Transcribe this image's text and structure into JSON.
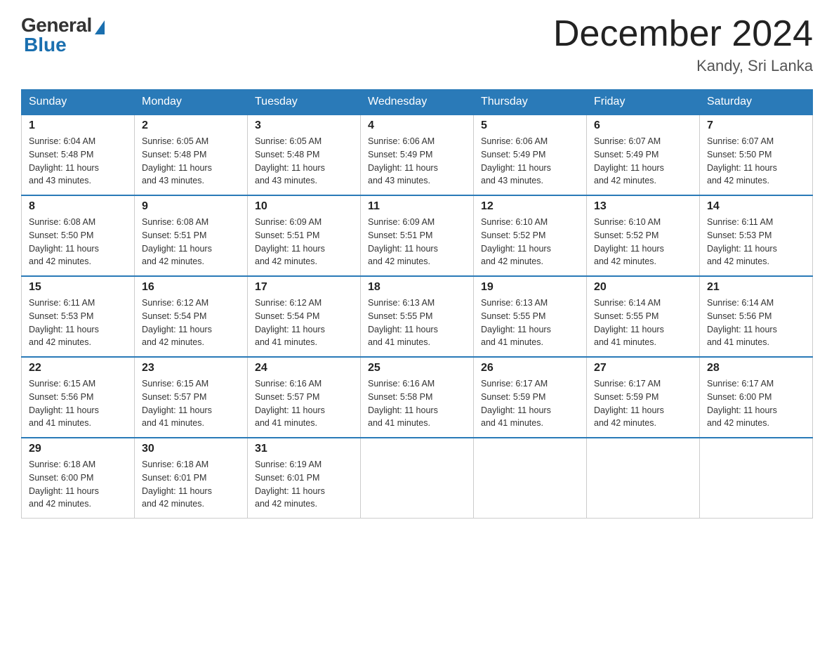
{
  "logo": {
    "general": "General",
    "blue": "Blue"
  },
  "title": "December 2024",
  "location": "Kandy, Sri Lanka",
  "weekdays": [
    "Sunday",
    "Monday",
    "Tuesday",
    "Wednesday",
    "Thursday",
    "Friday",
    "Saturday"
  ],
  "weeks": [
    [
      {
        "day": "1",
        "sunrise": "6:04 AM",
        "sunset": "5:48 PM",
        "daylight": "11 hours and 43 minutes."
      },
      {
        "day": "2",
        "sunrise": "6:05 AM",
        "sunset": "5:48 PM",
        "daylight": "11 hours and 43 minutes."
      },
      {
        "day": "3",
        "sunrise": "6:05 AM",
        "sunset": "5:48 PM",
        "daylight": "11 hours and 43 minutes."
      },
      {
        "day": "4",
        "sunrise": "6:06 AM",
        "sunset": "5:49 PM",
        "daylight": "11 hours and 43 minutes."
      },
      {
        "day": "5",
        "sunrise": "6:06 AM",
        "sunset": "5:49 PM",
        "daylight": "11 hours and 43 minutes."
      },
      {
        "day": "6",
        "sunrise": "6:07 AM",
        "sunset": "5:49 PM",
        "daylight": "11 hours and 42 minutes."
      },
      {
        "day": "7",
        "sunrise": "6:07 AM",
        "sunset": "5:50 PM",
        "daylight": "11 hours and 42 minutes."
      }
    ],
    [
      {
        "day": "8",
        "sunrise": "6:08 AM",
        "sunset": "5:50 PM",
        "daylight": "11 hours and 42 minutes."
      },
      {
        "day": "9",
        "sunrise": "6:08 AM",
        "sunset": "5:51 PM",
        "daylight": "11 hours and 42 minutes."
      },
      {
        "day": "10",
        "sunrise": "6:09 AM",
        "sunset": "5:51 PM",
        "daylight": "11 hours and 42 minutes."
      },
      {
        "day": "11",
        "sunrise": "6:09 AM",
        "sunset": "5:51 PM",
        "daylight": "11 hours and 42 minutes."
      },
      {
        "day": "12",
        "sunrise": "6:10 AM",
        "sunset": "5:52 PM",
        "daylight": "11 hours and 42 minutes."
      },
      {
        "day": "13",
        "sunrise": "6:10 AM",
        "sunset": "5:52 PM",
        "daylight": "11 hours and 42 minutes."
      },
      {
        "day": "14",
        "sunrise": "6:11 AM",
        "sunset": "5:53 PM",
        "daylight": "11 hours and 42 minutes."
      }
    ],
    [
      {
        "day": "15",
        "sunrise": "6:11 AM",
        "sunset": "5:53 PM",
        "daylight": "11 hours and 42 minutes."
      },
      {
        "day": "16",
        "sunrise": "6:12 AM",
        "sunset": "5:54 PM",
        "daylight": "11 hours and 42 minutes."
      },
      {
        "day": "17",
        "sunrise": "6:12 AM",
        "sunset": "5:54 PM",
        "daylight": "11 hours and 41 minutes."
      },
      {
        "day": "18",
        "sunrise": "6:13 AM",
        "sunset": "5:55 PM",
        "daylight": "11 hours and 41 minutes."
      },
      {
        "day": "19",
        "sunrise": "6:13 AM",
        "sunset": "5:55 PM",
        "daylight": "11 hours and 41 minutes."
      },
      {
        "day": "20",
        "sunrise": "6:14 AM",
        "sunset": "5:55 PM",
        "daylight": "11 hours and 41 minutes."
      },
      {
        "day": "21",
        "sunrise": "6:14 AM",
        "sunset": "5:56 PM",
        "daylight": "11 hours and 41 minutes."
      }
    ],
    [
      {
        "day": "22",
        "sunrise": "6:15 AM",
        "sunset": "5:56 PM",
        "daylight": "11 hours and 41 minutes."
      },
      {
        "day": "23",
        "sunrise": "6:15 AM",
        "sunset": "5:57 PM",
        "daylight": "11 hours and 41 minutes."
      },
      {
        "day": "24",
        "sunrise": "6:16 AM",
        "sunset": "5:57 PM",
        "daylight": "11 hours and 41 minutes."
      },
      {
        "day": "25",
        "sunrise": "6:16 AM",
        "sunset": "5:58 PM",
        "daylight": "11 hours and 41 minutes."
      },
      {
        "day": "26",
        "sunrise": "6:17 AM",
        "sunset": "5:59 PM",
        "daylight": "11 hours and 41 minutes."
      },
      {
        "day": "27",
        "sunrise": "6:17 AM",
        "sunset": "5:59 PM",
        "daylight": "11 hours and 42 minutes."
      },
      {
        "day": "28",
        "sunrise": "6:17 AM",
        "sunset": "6:00 PM",
        "daylight": "11 hours and 42 minutes."
      }
    ],
    [
      {
        "day": "29",
        "sunrise": "6:18 AM",
        "sunset": "6:00 PM",
        "daylight": "11 hours and 42 minutes."
      },
      {
        "day": "30",
        "sunrise": "6:18 AM",
        "sunset": "6:01 PM",
        "daylight": "11 hours and 42 minutes."
      },
      {
        "day": "31",
        "sunrise": "6:19 AM",
        "sunset": "6:01 PM",
        "daylight": "11 hours and 42 minutes."
      },
      null,
      null,
      null,
      null
    ]
  ],
  "labels": {
    "sunrise": "Sunrise:",
    "sunset": "Sunset:",
    "daylight": "Daylight:"
  }
}
